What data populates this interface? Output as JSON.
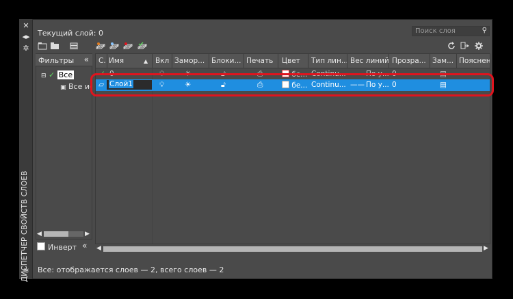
{
  "palette": {
    "title_vertical": "ДИСПЕТЧЕР СВОЙСТВ СЛОЕВ",
    "icons": [
      "close-icon",
      "auto-hide-icon",
      "properties-icon"
    ]
  },
  "header": {
    "current_layer": "Текущий слой: 0",
    "search_placeholder": "Поиск слоя"
  },
  "toolbar": {
    "left_icons": [
      "new-property-filter-icon",
      "new-group-filter-icon",
      "layer-states-manager-icon",
      "new-layer-icon",
      "new-layer-vp-frozen-icon",
      "delete-layer-icon",
      "set-current-icon"
    ],
    "right_icons": [
      "refresh-icon",
      "settings-icon",
      "gear-icon"
    ]
  },
  "filters": {
    "title": "Фильтры",
    "collapse": "«",
    "tree": {
      "root": "Все",
      "child": "Все используемые слои"
    },
    "invert_label": "Инверт"
  },
  "grid": {
    "columns": [
      "С.",
      "Имя",
      "Вкл",
      "Замор...",
      "Блоки...",
      "Печать",
      "Цвет",
      "Тип лин...",
      "Вес линий",
      "Прозра...",
      "Зам...",
      "Пояснени"
    ],
    "rows": [
      {
        "status": "✓",
        "name": "0",
        "color": "бе...",
        "linetype": "Continu...",
        "lineweight": "По у...",
        "transparency": "0"
      },
      {
        "status": "▱",
        "name": "Слой1",
        "color": "бе...",
        "linetype": "Continu...",
        "lineweight": "По у...",
        "transparency": "0"
      }
    ],
    "selected_row": 1,
    "colors": {
      "selection": "#1f8ee0",
      "highlight_outline": "#e0141e"
    }
  },
  "status_bar": {
    "text": "Все: отображается слоев — 2, всего слоев — 2"
  }
}
